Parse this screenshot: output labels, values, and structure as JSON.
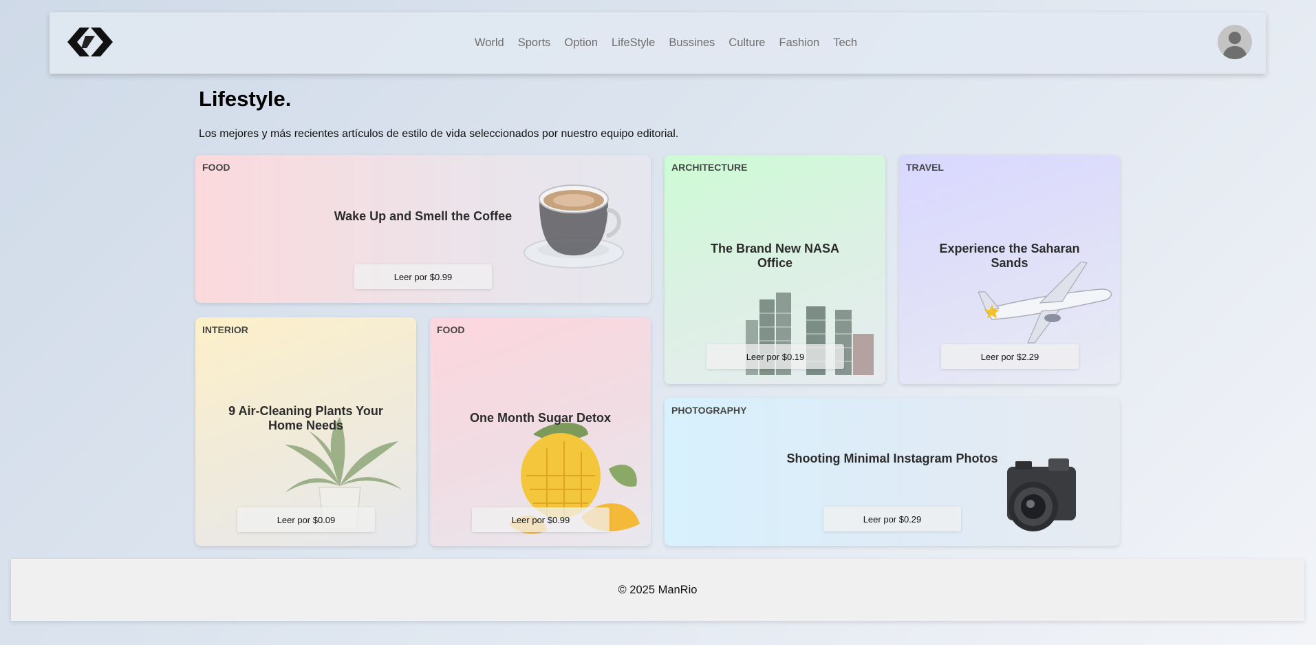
{
  "nav": {
    "items": [
      "World",
      "Sports",
      "Option",
      "LifeStyle",
      "Bussines",
      "Culture",
      "Fashion",
      "Tech"
    ]
  },
  "page": {
    "title": "Lifestyle.",
    "subtitle": "Los mejores y más recientes artículos de estilo de vida seleccionados por nuestro equipo editorial."
  },
  "cards": {
    "coffee": {
      "category": "FOOD",
      "title": "Wake Up and Smell the Coffee",
      "button": "Leer por $0.99",
      "icon": "coffee-cup-icon"
    },
    "arch": {
      "category": "ARCHITECTURE",
      "title": "The Brand New NASA Office",
      "button": "Leer por $0.19",
      "icon": "buildings-icon"
    },
    "travel": {
      "category": "TRAVEL",
      "title": "Experience the Saharan Sands",
      "button": "Leer por $2.29",
      "icon": "airplane-icon"
    },
    "interior": {
      "category": "INTERIOR",
      "title": "9 Air-Cleaning Plants Your Home Needs",
      "button": "Leer por $0.09",
      "icon": "plant-icon"
    },
    "sugar": {
      "category": "FOOD",
      "title": "One Month Sugar Detox",
      "button": "Leer por $0.99",
      "icon": "mango-icon"
    },
    "photo": {
      "category": "PHOTOGRAPHY",
      "title": "Shooting Minimal Instagram Photos",
      "button": "Leer por $0.29",
      "icon": "camera-icon"
    }
  },
  "footer": {
    "text": "© 2025 ManRio"
  },
  "colors": {
    "background": "#dde5ef",
    "footer": "#f0f0f0",
    "text": "#2b2b2b"
  }
}
